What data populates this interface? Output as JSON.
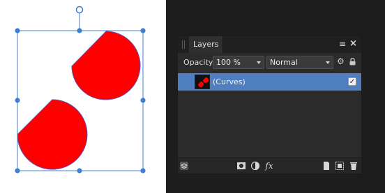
{
  "panel": {
    "tab_label": "Layers",
    "menu_icon": "≡",
    "close_icon": "×",
    "opacity_label": "Opacity:",
    "opacity_value": "100 %",
    "blend_mode": "Normal"
  },
  "layers": [
    {
      "name": "(Curves)",
      "visible": true,
      "selected": true
    }
  ],
  "colors": {
    "shape_fill": "#ff0000",
    "selection": "#3d7fd1",
    "layer_highlight": "#4f7fc1"
  },
  "icons": {
    "fx": "fx"
  }
}
